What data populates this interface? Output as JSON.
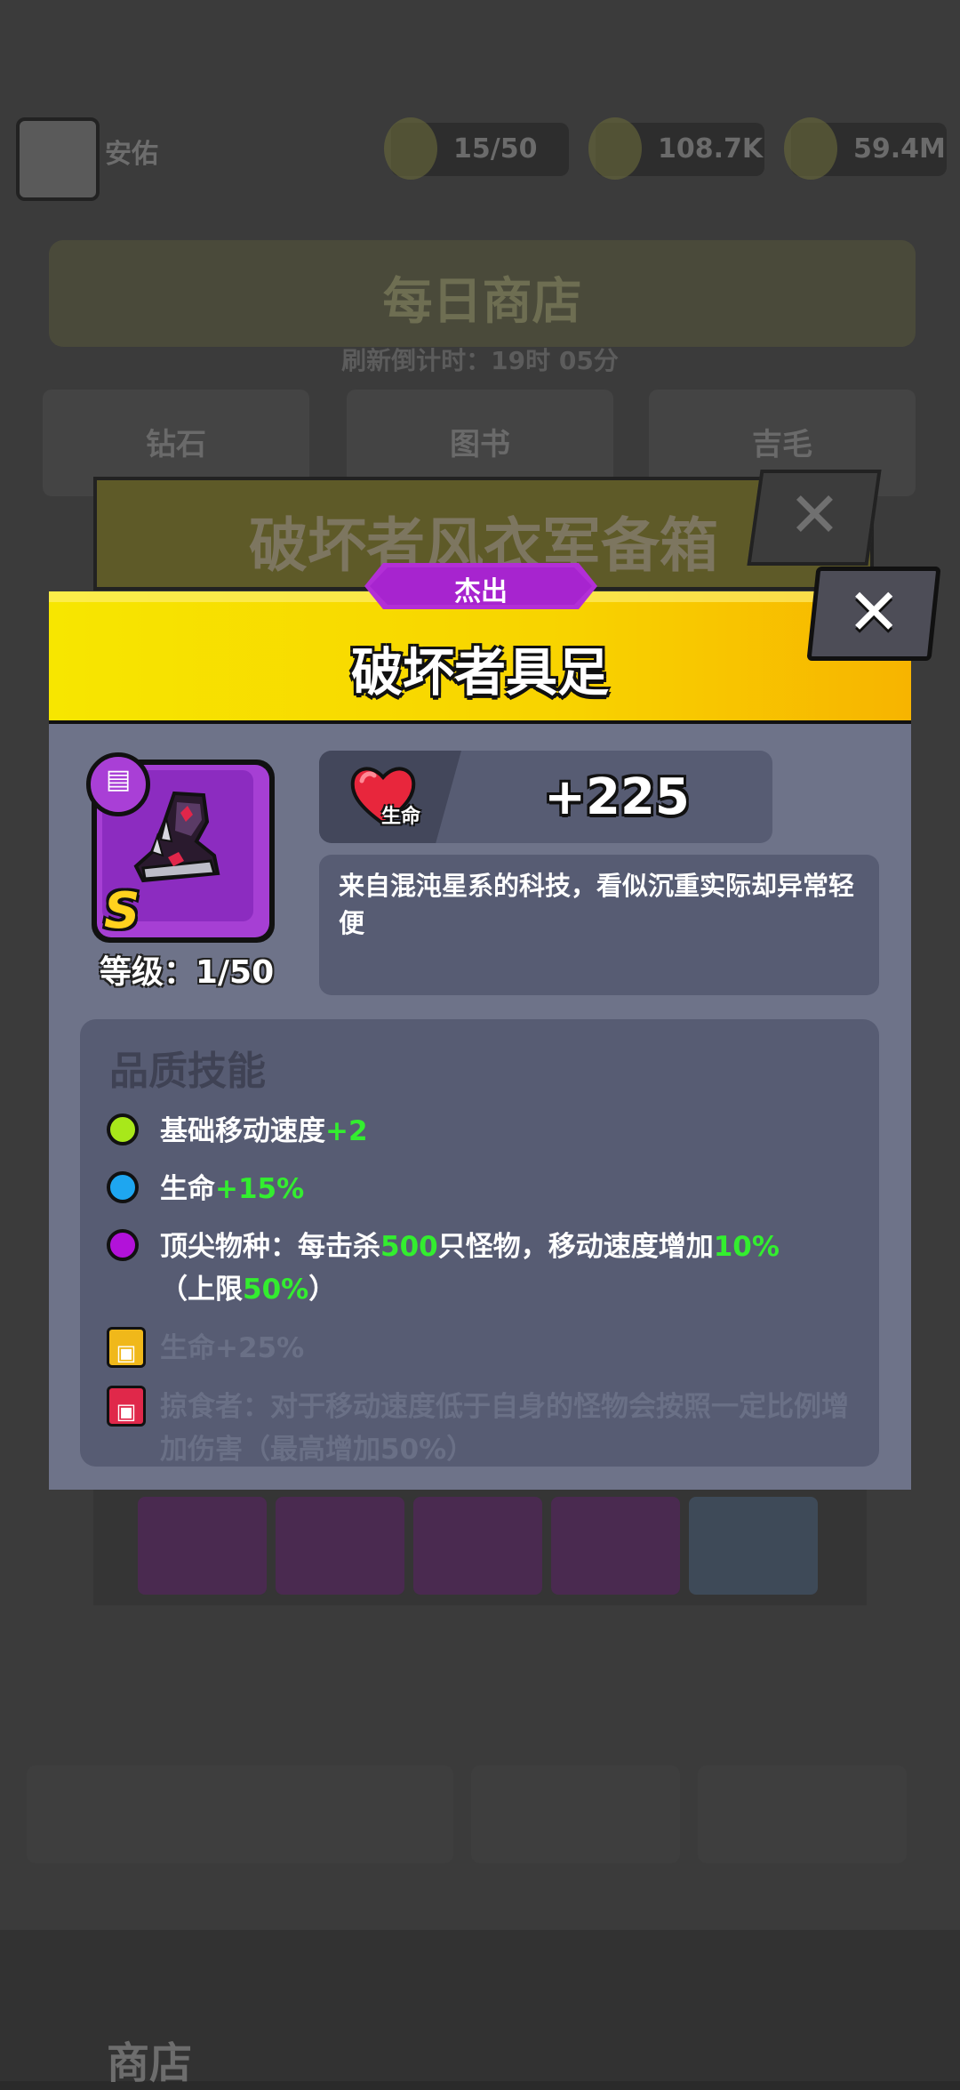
{
  "background": {
    "player_name": "安佑",
    "player_sub": "",
    "stamina": "15/50",
    "coins": "108.7K",
    "gems": "59.4M",
    "shop_title": "每日商店",
    "refresh_text": "刷新倒计时：19时 05分",
    "shop_cards": [
      "钻石",
      "图书",
      "吉毛"
    ],
    "box_title": "破坏者风衣军备箱",
    "box_close": "✕",
    "nav_label": "商店"
  },
  "modal": {
    "rarity": "杰出",
    "title": "破坏者具足",
    "close_label": "✕",
    "item": {
      "icon": "boot-icon",
      "type_badge": "▤",
      "grade": "S",
      "level": "等级：1/50"
    },
    "stat": {
      "icon": "heart-icon",
      "label": "生命",
      "value": "+225"
    },
    "description": "来自混沌星系的科技，看似沉重实际却异常轻便",
    "skills_title": "品质技能",
    "skills": [
      {
        "dot_color": "#a8e81a",
        "text": "基础移动速度",
        "value": "+2",
        "extra": ""
      },
      {
        "dot_color": "#1ea6f0",
        "text": "生命",
        "value": "+15%",
        "extra": ""
      },
      {
        "dot_color": "#b212d9",
        "text_parts": [
          "顶尖物种：每击杀",
          "500",
          "只怪物，移动速度增加",
          "10%",
          "（上限",
          "50%",
          "）"
        ]
      },
      {
        "lock_color": "#f0b81a",
        "text": "生命+25%",
        "locked": true
      },
      {
        "lock_color": "#e0284a",
        "text": "掠食者：对于移动速度低于自身的怪物会按照一定比例增加伤害（最高增加50%）",
        "locked": true
      }
    ],
    "colors": {
      "header_yellow": "#f7d300",
      "rarity_purple": "#a724cf",
      "body_bg": "#6e7389",
      "highlight_green": "#33ee2f"
    }
  }
}
